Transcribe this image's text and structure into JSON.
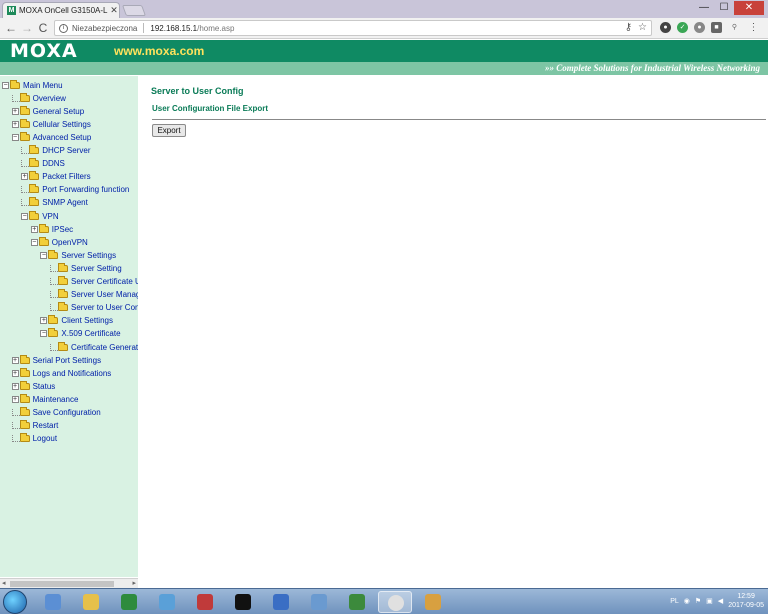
{
  "browser": {
    "tab_title": "MOXA OnCell G3150A-L",
    "tab_favicon_text": "M",
    "insecure_label": "Niezabezpieczona",
    "url_host": "192.168.15.1",
    "url_path": "/home.asp",
    "window_buttons": [
      "—",
      "☐",
      "✕"
    ],
    "nav": {
      "back": "←",
      "forward": "→",
      "reload": "C"
    }
  },
  "header": {
    "logo": "MOXA",
    "logo_url": "www.moxa.com",
    "tagline": "»» Complete Solutions for Industrial Wireless Networking",
    "colors": {
      "banner": "#0f8a63",
      "tagline_bar": "#7dc5a4",
      "url": "#ffe25c"
    }
  },
  "tree": [
    {
      "label": "Main Menu",
      "level": 0,
      "expander": "-"
    },
    {
      "label": "Overview",
      "level": 1,
      "expander": ""
    },
    {
      "label": "General Setup",
      "level": 1,
      "expander": "+"
    },
    {
      "label": "Cellular Settings",
      "level": 1,
      "expander": "+"
    },
    {
      "label": "Advanced Setup",
      "level": 1,
      "expander": "-"
    },
    {
      "label": "DHCP Server",
      "level": 2,
      "expander": ""
    },
    {
      "label": "DDNS",
      "level": 2,
      "expander": ""
    },
    {
      "label": "Packet Filters",
      "level": 2,
      "expander": "+"
    },
    {
      "label": "Port Forwarding function",
      "level": 2,
      "expander": ""
    },
    {
      "label": "SNMP Agent",
      "level": 2,
      "expander": ""
    },
    {
      "label": "VPN",
      "level": 2,
      "expander": "-"
    },
    {
      "label": "IPSec",
      "level": 3,
      "expander": "+"
    },
    {
      "label": "OpenVPN",
      "level": 3,
      "expander": "-"
    },
    {
      "label": "Server Settings",
      "level": 4,
      "expander": "-"
    },
    {
      "label": "Server Setting",
      "level": 5,
      "expander": ""
    },
    {
      "label": "Server Certificate Up",
      "level": 5,
      "expander": ""
    },
    {
      "label": "Server User Manager",
      "level": 5,
      "expander": ""
    },
    {
      "label": "Server to User Confi",
      "level": 5,
      "expander": ""
    },
    {
      "label": "Client Settings",
      "level": 4,
      "expander": "+"
    },
    {
      "label": "X.509 Certificate",
      "level": 4,
      "expander": "-"
    },
    {
      "label": "Certificate Generatio",
      "level": 5,
      "expander": ""
    },
    {
      "label": "Serial Port Settings",
      "level": 1,
      "expander": "+"
    },
    {
      "label": "Logs and Notifications",
      "level": 1,
      "expander": "+"
    },
    {
      "label": "Status",
      "level": 1,
      "expander": "+"
    },
    {
      "label": "Maintenance",
      "level": 1,
      "expander": "+"
    },
    {
      "label": "Save Configuration",
      "level": 1,
      "expander": ""
    },
    {
      "label": "Restart",
      "level": 1,
      "expander": ""
    },
    {
      "label": "Logout",
      "level": 1,
      "expander": ""
    }
  ],
  "main": {
    "page_title": "Server to User Config",
    "section_title": "User Configuration File Export",
    "export_label": "Export"
  },
  "taskbar": {
    "apps": [
      "windows-explorer",
      "file-manager",
      "excel",
      "notepad",
      "snipping-tool",
      "command-prompt",
      "network-tool",
      "remote-desktop",
      "task-manager",
      "chrome",
      "paint"
    ],
    "active_app": "chrome",
    "language": "PL",
    "time": "12:59",
    "date": "2017-09-05"
  }
}
